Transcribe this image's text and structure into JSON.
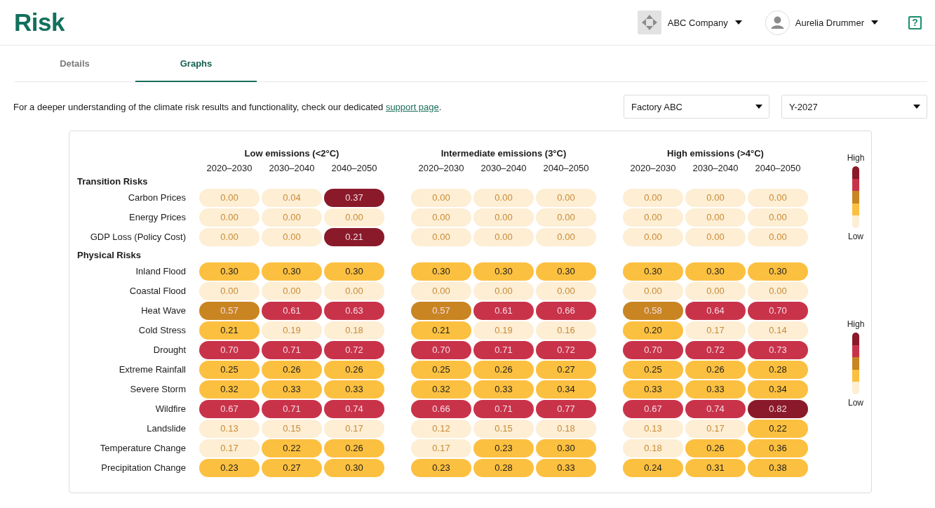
{
  "header": {
    "title": "Risk",
    "company": "ABC Company",
    "user": "Aurelia Drummer",
    "help": "?"
  },
  "tabs": [
    {
      "label": "Details",
      "selected": false
    },
    {
      "label": "Graphs",
      "selected": true
    }
  ],
  "info": {
    "text": "For a deeper understanding of the climate risk results and functionality, check our dedicated ",
    "link": "support page",
    "text_end": "."
  },
  "filters": [
    {
      "value": "Factory ABC"
    },
    {
      "value": "Y-2027"
    }
  ],
  "heatmap": {
    "scenarios": [
      {
        "title": "Low emissions (<2°C)",
        "periods": [
          "2020–2030",
          "2030–2040",
          "2040–2050"
        ]
      },
      {
        "title": "Intermediate emissions (3°C)",
        "periods": [
          "2020–2030",
          "2030–2040",
          "2040–2050"
        ]
      },
      {
        "title": "High emissions (>4°C)",
        "periods": [
          "2020–2030",
          "2030–2040",
          "2040–2050"
        ]
      }
    ],
    "sections": [
      {
        "title": "Transition Risks",
        "legend": {
          "high": "High",
          "low": "Low",
          "steps": [
            {
              "color": "#8a1a2a"
            },
            {
              "color": "#c9334a"
            },
            {
              "color": "#c98522"
            },
            {
              "color": "#fcc040"
            },
            {
              "color": "#fdeed4"
            }
          ]
        },
        "rows": [
          {
            "label": "Carbon Prices",
            "cells": [
              {
                "value": "0.00",
                "color": "#fdeed4"
              },
              {
                "value": "0.04",
                "color": "#fdeed4"
              },
              {
                "value": "0.37",
                "color": "#8a1a2a"
              },
              {
                "value": "0.00",
                "color": "#fdeed4"
              },
              {
                "value": "0.00",
                "color": "#fdeed4"
              },
              {
                "value": "0.00",
                "color": "#fdeed4"
              },
              {
                "value": "0.00",
                "color": "#fdeed4"
              },
              {
                "value": "0.00",
                "color": "#fdeed4"
              },
              {
                "value": "0.00",
                "color": "#fdeed4"
              }
            ]
          },
          {
            "label": "Energy Prices",
            "cells": [
              {
                "value": "0.00",
                "color": "#fdeed4"
              },
              {
                "value": "0.00",
                "color": "#fdeed4"
              },
              {
                "value": "0.00",
                "color": "#fdeed4"
              },
              {
                "value": "0.00",
                "color": "#fdeed4"
              },
              {
                "value": "0.00",
                "color": "#fdeed4"
              },
              {
                "value": "0.00",
                "color": "#fdeed4"
              },
              {
                "value": "0.00",
                "color": "#fdeed4"
              },
              {
                "value": "0.00",
                "color": "#fdeed4"
              },
              {
                "value": "0.00",
                "color": "#fdeed4"
              }
            ]
          },
          {
            "label": "GDP Loss (Policy Cost)",
            "cells": [
              {
                "value": "0.00",
                "color": "#fdeed4"
              },
              {
                "value": "0.00",
                "color": "#fdeed4"
              },
              {
                "value": "0.21",
                "color": "#8a1a2a"
              },
              {
                "value": "0.00",
                "color": "#fdeed4"
              },
              {
                "value": "0.00",
                "color": "#fdeed4"
              },
              {
                "value": "0.00",
                "color": "#fdeed4"
              },
              {
                "value": "0.00",
                "color": "#fdeed4"
              },
              {
                "value": "0.00",
                "color": "#fdeed4"
              },
              {
                "value": "0.00",
                "color": "#fdeed4"
              }
            ]
          }
        ]
      },
      {
        "title": "Physical Risks",
        "legend": {
          "high": "High",
          "low": "Low",
          "steps": [
            {
              "color": "#8a1a2a"
            },
            {
              "color": "#c9334a"
            },
            {
              "color": "#c98522"
            },
            {
              "color": "#fcc040"
            },
            {
              "color": "#fdeed4"
            }
          ]
        },
        "rows": [
          {
            "label": "Inland Flood",
            "cells": [
              {
                "value": "0.30",
                "color": "#fcc040"
              },
              {
                "value": "0.30",
                "color": "#fcc040"
              },
              {
                "value": "0.30",
                "color": "#fcc040"
              },
              {
                "value": "0.30",
                "color": "#fcc040"
              },
              {
                "value": "0.30",
                "color": "#fcc040"
              },
              {
                "value": "0.30",
                "color": "#fcc040"
              },
              {
                "value": "0.30",
                "color": "#fcc040"
              },
              {
                "value": "0.30",
                "color": "#fcc040"
              },
              {
                "value": "0.30",
                "color": "#fcc040"
              }
            ]
          },
          {
            "label": "Coastal Flood",
            "cells": [
              {
                "value": "0.00",
                "color": "#fdeed4"
              },
              {
                "value": "0.00",
                "color": "#fdeed4"
              },
              {
                "value": "0.00",
                "color": "#fdeed4"
              },
              {
                "value": "0.00",
                "color": "#fdeed4"
              },
              {
                "value": "0.00",
                "color": "#fdeed4"
              },
              {
                "value": "0.00",
                "color": "#fdeed4"
              },
              {
                "value": "0.00",
                "color": "#fdeed4"
              },
              {
                "value": "0.00",
                "color": "#fdeed4"
              },
              {
                "value": "0.00",
                "color": "#fdeed4"
              }
            ]
          },
          {
            "label": "Heat Wave",
            "cells": [
              {
                "value": "0.57",
                "color": "#c98522"
              },
              {
                "value": "0.61",
                "color": "#c9334a"
              },
              {
                "value": "0.63",
                "color": "#c9334a"
              },
              {
                "value": "0.57",
                "color": "#c98522"
              },
              {
                "value": "0.61",
                "color": "#c9334a"
              },
              {
                "value": "0.66",
                "color": "#c9334a"
              },
              {
                "value": "0.58",
                "color": "#c98522"
              },
              {
                "value": "0.64",
                "color": "#c9334a"
              },
              {
                "value": "0.70",
                "color": "#c9334a"
              }
            ]
          },
          {
            "label": "Cold Stress",
            "cells": [
              {
                "value": "0.21",
                "color": "#fcc040"
              },
              {
                "value": "0.19",
                "color": "#fdeed4"
              },
              {
                "value": "0.18",
                "color": "#fdeed4"
              },
              {
                "value": "0.21",
                "color": "#fcc040"
              },
              {
                "value": "0.19",
                "color": "#fdeed4"
              },
              {
                "value": "0.16",
                "color": "#fdeed4"
              },
              {
                "value": "0.20",
                "color": "#fcc040"
              },
              {
                "value": "0.17",
                "color": "#fdeed4"
              },
              {
                "value": "0.14",
                "color": "#fdeed4"
              }
            ]
          },
          {
            "label": "Drought",
            "cells": [
              {
                "value": "0.70",
                "color": "#c9334a"
              },
              {
                "value": "0.71",
                "color": "#c9334a"
              },
              {
                "value": "0.72",
                "color": "#c9334a"
              },
              {
                "value": "0.70",
                "color": "#c9334a"
              },
              {
                "value": "0.71",
                "color": "#c9334a"
              },
              {
                "value": "0.72",
                "color": "#c9334a"
              },
              {
                "value": "0.70",
                "color": "#c9334a"
              },
              {
                "value": "0.72",
                "color": "#c9334a"
              },
              {
                "value": "0.73",
                "color": "#c9334a"
              }
            ]
          },
          {
            "label": "Extreme Rainfall",
            "cells": [
              {
                "value": "0.25",
                "color": "#fcc040"
              },
              {
                "value": "0.26",
                "color": "#fcc040"
              },
              {
                "value": "0.26",
                "color": "#fcc040"
              },
              {
                "value": "0.25",
                "color": "#fcc040"
              },
              {
                "value": "0.26",
                "color": "#fcc040"
              },
              {
                "value": "0.27",
                "color": "#fcc040"
              },
              {
                "value": "0.25",
                "color": "#fcc040"
              },
              {
                "value": "0.26",
                "color": "#fcc040"
              },
              {
                "value": "0.28",
                "color": "#fcc040"
              }
            ]
          },
          {
            "label": "Severe Storm",
            "cells": [
              {
                "value": "0.32",
                "color": "#fcc040"
              },
              {
                "value": "0.33",
                "color": "#fcc040"
              },
              {
                "value": "0.33",
                "color": "#fcc040"
              },
              {
                "value": "0.32",
                "color": "#fcc040"
              },
              {
                "value": "0.33",
                "color": "#fcc040"
              },
              {
                "value": "0.34",
                "color": "#fcc040"
              },
              {
                "value": "0.33",
                "color": "#fcc040"
              },
              {
                "value": "0.33",
                "color": "#fcc040"
              },
              {
                "value": "0.34",
                "color": "#fcc040"
              }
            ]
          },
          {
            "label": "Wildfire",
            "cells": [
              {
                "value": "0.67",
                "color": "#c9334a"
              },
              {
                "value": "0.71",
                "color": "#c9334a"
              },
              {
                "value": "0.74",
                "color": "#c9334a"
              },
              {
                "value": "0.66",
                "color": "#c9334a"
              },
              {
                "value": "0.71",
                "color": "#c9334a"
              },
              {
                "value": "0.77",
                "color": "#c9334a"
              },
              {
                "value": "0.67",
                "color": "#c9334a"
              },
              {
                "value": "0.74",
                "color": "#c9334a"
              },
              {
                "value": "0.82",
                "color": "#8a1a2a"
              }
            ]
          },
          {
            "label": "Landslide",
            "cells": [
              {
                "value": "0.13",
                "color": "#fdeed4"
              },
              {
                "value": "0.15",
                "color": "#fdeed4"
              },
              {
                "value": "0.17",
                "color": "#fdeed4"
              },
              {
                "value": "0.12",
                "color": "#fdeed4"
              },
              {
                "value": "0.15",
                "color": "#fdeed4"
              },
              {
                "value": "0.18",
                "color": "#fdeed4"
              },
              {
                "value": "0.13",
                "color": "#fdeed4"
              },
              {
                "value": "0.17",
                "color": "#fdeed4"
              },
              {
                "value": "0.22",
                "color": "#fcc040"
              }
            ]
          },
          {
            "label": "Temperature Change",
            "cells": [
              {
                "value": "0.17",
                "color": "#fdeed4"
              },
              {
                "value": "0.22",
                "color": "#fcc040"
              },
              {
                "value": "0.26",
                "color": "#fcc040"
              },
              {
                "value": "0.17",
                "color": "#fdeed4"
              },
              {
                "value": "0.23",
                "color": "#fcc040"
              },
              {
                "value": "0.30",
                "color": "#fcc040"
              },
              {
                "value": "0.18",
                "color": "#fdeed4"
              },
              {
                "value": "0.26",
                "color": "#fcc040"
              },
              {
                "value": "0.36",
                "color": "#fcc040"
              }
            ]
          },
          {
            "label": "Precipitation Change",
            "cells": [
              {
                "value": "0.23",
                "color": "#fcc040"
              },
              {
                "value": "0.27",
                "color": "#fcc040"
              },
              {
                "value": "0.30",
                "color": "#fcc040"
              },
              {
                "value": "0.23",
                "color": "#fcc040"
              },
              {
                "value": "0.28",
                "color": "#fcc040"
              },
              {
                "value": "0.33",
                "color": "#fcc040"
              },
              {
                "value": "0.24",
                "color": "#fcc040"
              },
              {
                "value": "0.31",
                "color": "#fcc040"
              },
              {
                "value": "0.38",
                "color": "#fcc040"
              }
            ]
          }
        ]
      }
    ]
  }
}
